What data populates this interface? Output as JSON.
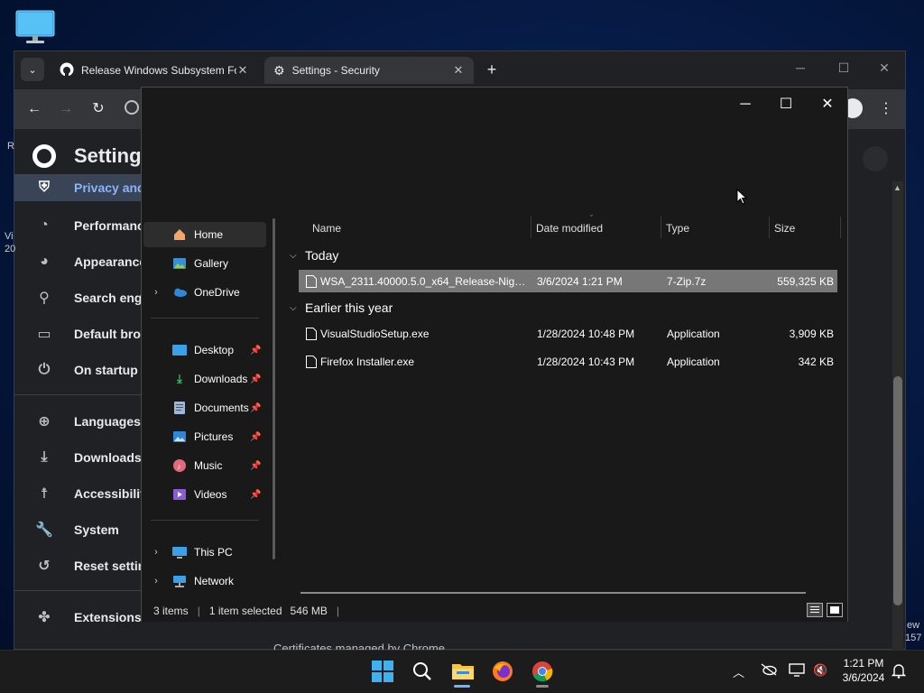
{
  "desktop": {
    "icon": "monitor-icon"
  },
  "chrome": {
    "tabs": [
      {
        "title": "Release Windows Subsystem Fo",
        "icon": "github-icon"
      },
      {
        "title": "Settings - Security",
        "icon": "gear-icon"
      }
    ],
    "settings_title": "Setting",
    "nav": [
      {
        "label": "Privacy and",
        "icon": "shield-icon"
      },
      {
        "label": "Performance",
        "icon": "speedometer-icon"
      },
      {
        "label": "Appearance",
        "icon": "palette-icon"
      },
      {
        "label": "Search engi",
        "icon": "search-icon"
      },
      {
        "label": "Default brow",
        "icon": "browser-icon"
      },
      {
        "label": "On startup",
        "icon": "power-icon"
      },
      {
        "label": "Languages",
        "icon": "globe-icon"
      },
      {
        "label": "Downloads",
        "icon": "download-icon"
      },
      {
        "label": "Accessibility",
        "icon": "accessibility-icon"
      },
      {
        "label": "System",
        "icon": "wrench-icon"
      },
      {
        "label": "Reset setting",
        "icon": "reset-icon"
      },
      {
        "label": "Extensions",
        "icon": "puzzle-icon"
      }
    ],
    "bottom_text": "Certificates managed by Chrome",
    "edge_left": [
      "R",
      "Vi",
      "20"
    ],
    "edge_right": [
      "ew",
      "157"
    ]
  },
  "explorer": {
    "nav_top": [
      {
        "label": "Home",
        "icon": "home-icon"
      },
      {
        "label": "Gallery",
        "icon": "gallery-icon"
      },
      {
        "label": "OneDrive",
        "icon": "onedrive-icon"
      }
    ],
    "nav_quick": [
      {
        "label": "Desktop",
        "icon": "desktop-folder-icon"
      },
      {
        "label": "Downloads",
        "icon": "downloads-folder-icon"
      },
      {
        "label": "Documents",
        "icon": "documents-folder-icon"
      },
      {
        "label": "Pictures",
        "icon": "pictures-folder-icon"
      },
      {
        "label": "Music",
        "icon": "music-folder-icon"
      },
      {
        "label": "Videos",
        "icon": "videos-folder-icon"
      }
    ],
    "nav_bottom": [
      {
        "label": "This PC",
        "icon": "this-pc-icon"
      },
      {
        "label": "Network",
        "icon": "network-icon"
      }
    ],
    "columns": {
      "name": "Name",
      "date": "Date modified",
      "type": "Type",
      "size": "Size"
    },
    "groups": [
      {
        "label": "Today",
        "files": [
          {
            "name": "WSA_2311.40000.5.0_x64_Release-Nightly...",
            "date": "3/6/2024 1:21 PM",
            "type": "7-Zip.7z",
            "size": "559,325 KB"
          }
        ]
      },
      {
        "label": "Earlier this year",
        "files": [
          {
            "name": "VisualStudioSetup.exe",
            "date": "1/28/2024 10:48 PM",
            "type": "Application",
            "size": "3,909 KB"
          },
          {
            "name": "Firefox Installer.exe",
            "date": "1/28/2024 10:43 PM",
            "type": "Application",
            "size": "342 KB"
          }
        ]
      }
    ],
    "status": {
      "items": "3 items",
      "selected": "1 item selected",
      "size": "546 MB"
    }
  },
  "taskbar": {
    "icons": [
      "windows-start-icon",
      "search-icon",
      "file-explorer-icon",
      "firefox-icon",
      "chrome-icon"
    ],
    "time": "1:21 PM",
    "date": "3/6/2024"
  }
}
